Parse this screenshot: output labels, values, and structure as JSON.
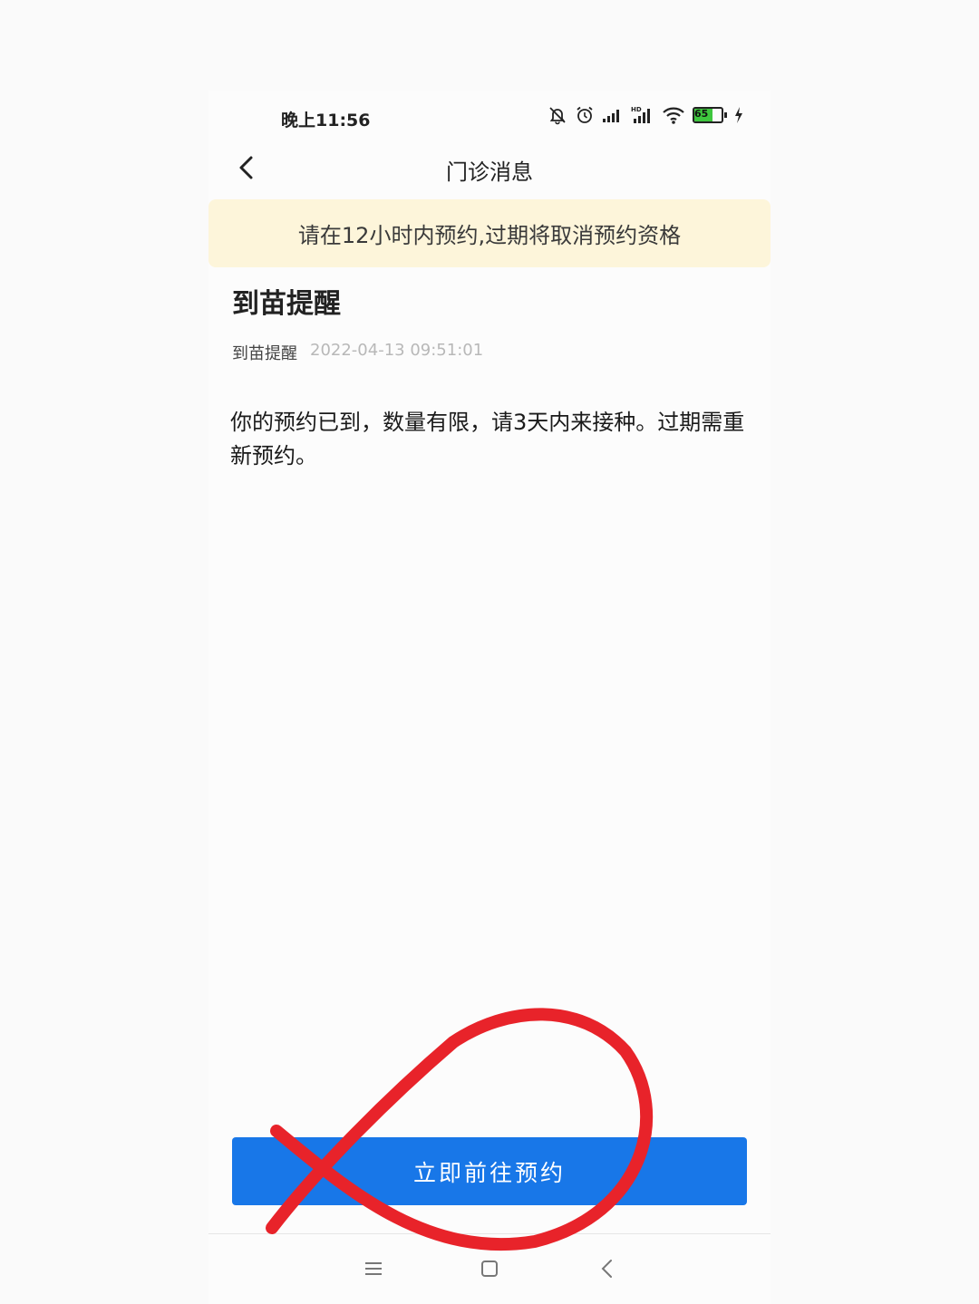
{
  "status_bar": {
    "time": "晚上11:56",
    "battery_level": "65",
    "battery_percent": 65,
    "icons": [
      "bell-off-icon",
      "alarm-icon",
      "signal-icon",
      "hd-signal-icon",
      "wifi-icon",
      "battery-icon",
      "charging-icon"
    ]
  },
  "header": {
    "title": "门诊消息"
  },
  "notice": {
    "text": "请在12小时内预约,过期将取消预约资格"
  },
  "message": {
    "title": "到苗提醒",
    "sender": "到苗提醒",
    "timestamp": "2022-04-13 09:51:01",
    "body": "你的预约已到，数量有限，请3天内来接种。过期需重新预约。"
  },
  "action": {
    "button_label": "立即前往预约"
  },
  "colors": {
    "primary": "#1877e8",
    "notice_bg": "#fdf5da",
    "annotation": "#e8232a",
    "battery": "#3ec63e"
  }
}
